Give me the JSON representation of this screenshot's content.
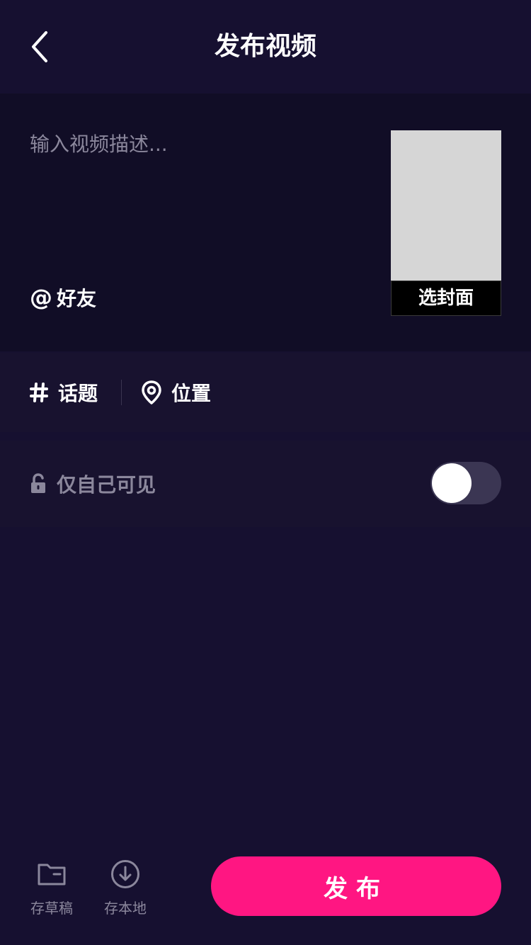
{
  "header": {
    "title": "发布视频",
    "back_icon": "chevron-left-icon"
  },
  "description": {
    "placeholder": "输入视频描述...",
    "value": "",
    "mention_symbol": "@",
    "mention_label": "好友",
    "cover_label": "选封面"
  },
  "tags": {
    "topic_label": "话题",
    "topic_icon": "hash-icon",
    "location_label": "位置",
    "location_icon": "map-pin-icon"
  },
  "privacy": {
    "label": "仅自己可见",
    "icon": "unlock-icon",
    "enabled": false
  },
  "bottom_bar": {
    "draft_label": "存草稿",
    "draft_icon": "folder-icon",
    "local_label": "存本地",
    "local_icon": "download-circle-icon",
    "publish_label": "发布"
  },
  "colors": {
    "background": "#161030",
    "card": "#110d26",
    "accent": "#ff1682",
    "muted_text": "#8b879c"
  }
}
